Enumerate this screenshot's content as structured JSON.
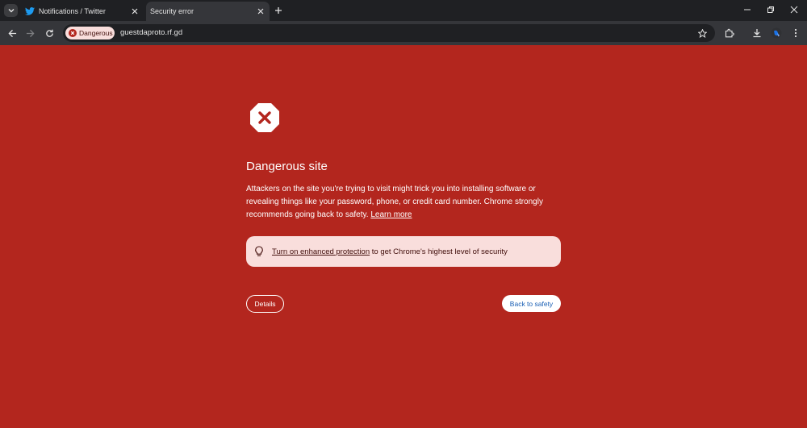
{
  "tabs": [
    {
      "title": "Notifications / Twitter",
      "icon": "twitter-icon",
      "active": false
    },
    {
      "title": "Security error",
      "icon": null,
      "active": true
    }
  ],
  "toolbar": {
    "security_chip": "Dangerous",
    "url": "guestdaproto.rf.gd"
  },
  "page": {
    "heading": "Dangerous site",
    "description": "Attackers on the site you're trying to visit might trick you into installing software or revealing things like your password, phone, or credit card number. Chrome strongly recommends going back to safety.",
    "learn_more": "Learn more",
    "enhanced_link": "Turn on enhanced protection",
    "enhanced_text": "to get Chrome's highest level of security",
    "details_button": "Details",
    "back_button": "Back to safety"
  },
  "colors": {
    "page_background": "#b3261e",
    "chip_background": "#f9dedc",
    "back_button_text": "#1a5fb4"
  }
}
